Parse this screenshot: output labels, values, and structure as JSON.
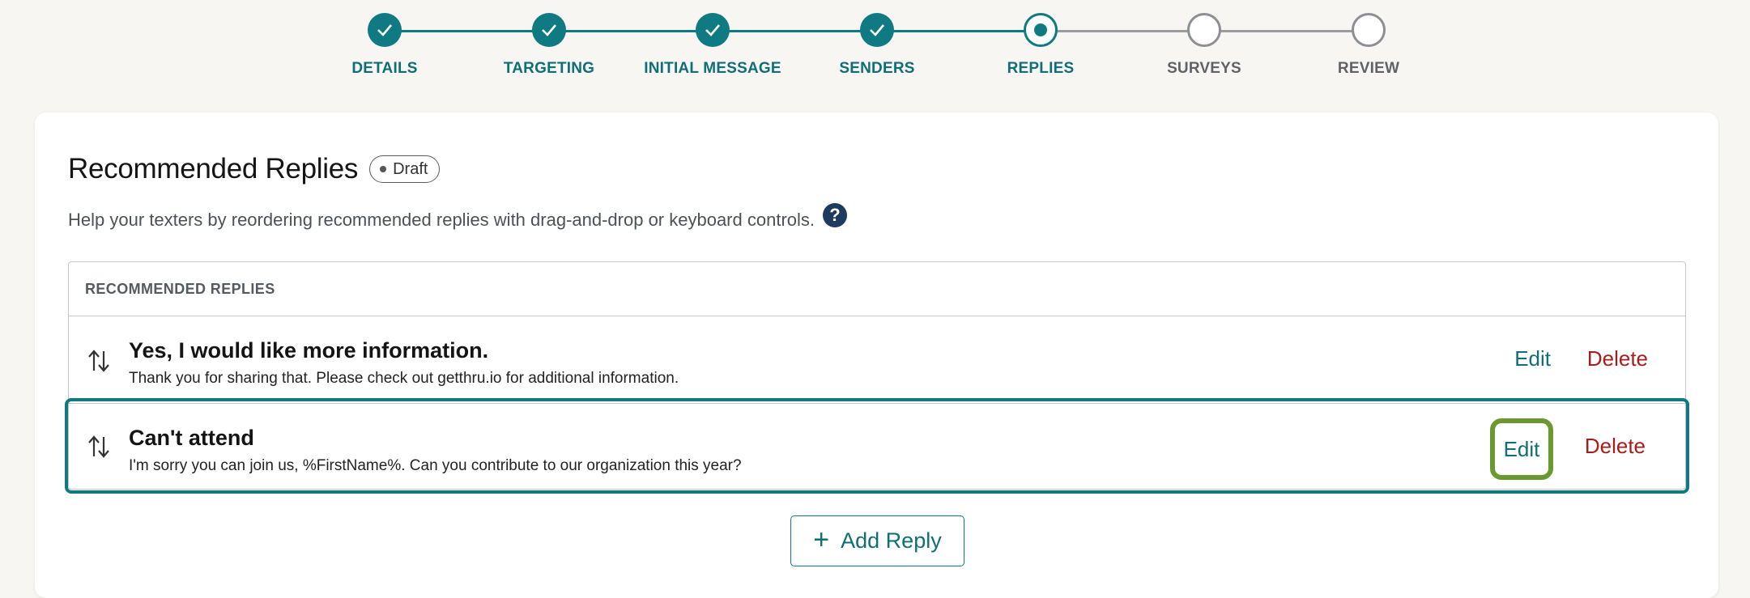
{
  "stepper": {
    "steps": [
      {
        "label": "DETAILS",
        "state": "done"
      },
      {
        "label": "TARGETING",
        "state": "done"
      },
      {
        "label": "INITIAL MESSAGE",
        "state": "done"
      },
      {
        "label": "SENDERS",
        "state": "done"
      },
      {
        "label": "REPLIES",
        "state": "current"
      },
      {
        "label": "SURVEYS",
        "state": "todo"
      },
      {
        "label": "REVIEW",
        "state": "todo"
      }
    ]
  },
  "page": {
    "title": "Recommended Replies",
    "status_badge": "Draft",
    "help_text": "Help your texters by reordering recommended replies with drag-and-drop or keyboard controls.",
    "help_icon": "question-circle-icon"
  },
  "table": {
    "header": "RECOMMENDED REPLIES",
    "rows": [
      {
        "title": "Yes, I would like more information.",
        "body": "Thank you for sharing that. Please check out getthru.io for additional information.",
        "edit_label": "Edit",
        "delete_label": "Delete"
      },
      {
        "title": "Can't attend",
        "body": "I'm sorry you can join us, %FirstName%. Can you contribute to our organization this year?",
        "edit_label": "Edit",
        "delete_label": "Delete"
      }
    ]
  },
  "add_reply": {
    "label": "Add Reply",
    "icon": "plus-icon"
  },
  "colors": {
    "accent": "#0f7a82",
    "danger": "#a81c1c",
    "focus_ring": "#6a9a2f",
    "inactive": "#8d8f94"
  }
}
